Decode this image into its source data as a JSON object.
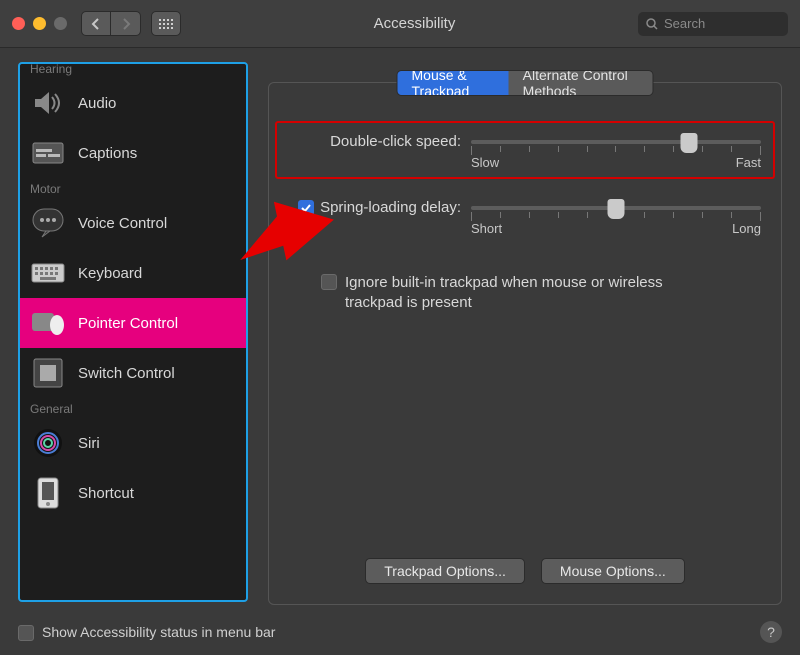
{
  "window": {
    "title": "Accessibility"
  },
  "search": {
    "placeholder": "Search"
  },
  "sidebar": {
    "sections": [
      {
        "header": "Hearing",
        "items": [
          {
            "label": "Audio",
            "icon": "speaker"
          },
          {
            "label": "Captions",
            "icon": "captions"
          }
        ]
      },
      {
        "header": "Motor",
        "items": [
          {
            "label": "Voice Control",
            "icon": "voice"
          },
          {
            "label": "Keyboard",
            "icon": "keyboard"
          },
          {
            "label": "Pointer Control",
            "icon": "pointer",
            "selected": true
          },
          {
            "label": "Switch Control",
            "icon": "switch"
          }
        ]
      },
      {
        "header": "General",
        "items": [
          {
            "label": "Siri",
            "icon": "siri"
          },
          {
            "label": "Shortcut",
            "icon": "shortcut"
          }
        ]
      }
    ]
  },
  "tabs": {
    "active": "Mouse & Trackpad",
    "inactive": "Alternate Control Methods"
  },
  "settings": {
    "doubleClick": {
      "label": "Double-click speed:",
      "low": "Slow",
      "high": "Fast",
      "value": 75
    },
    "springLoad": {
      "label": "Spring-loading delay:",
      "low": "Short",
      "high": "Long",
      "value": 50,
      "checked": true
    },
    "ignoreTrackpad": {
      "label": "Ignore built-in trackpad when mouse or wireless trackpad is present",
      "checked": false
    }
  },
  "buttons": {
    "trackpad": "Trackpad Options...",
    "mouse": "Mouse Options..."
  },
  "footer": {
    "statusLabel": "Show Accessibility status in menu bar",
    "checked": false
  }
}
